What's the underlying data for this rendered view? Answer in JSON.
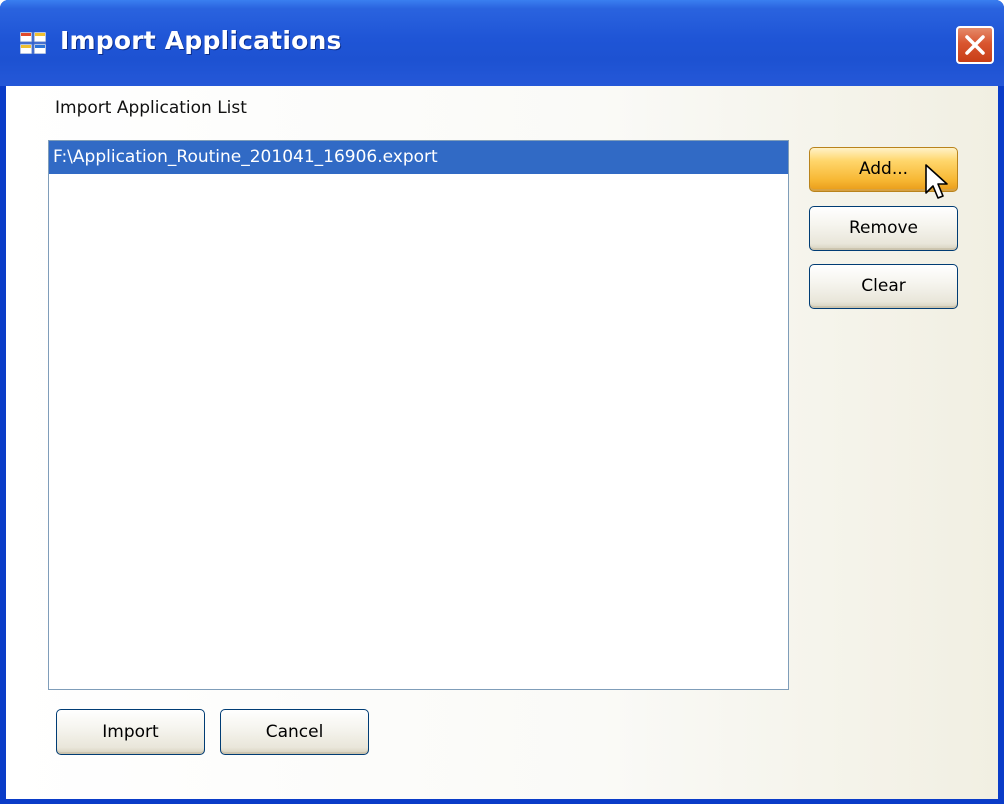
{
  "window": {
    "title": "Import Applications",
    "icon": "app-window-icon",
    "close_icon": "close-icon"
  },
  "form": {
    "list_label": "Import Application List",
    "list_items": [
      {
        "text": "F:\\Application_Routine_201041_16906.export",
        "selected": true
      }
    ]
  },
  "buttons": {
    "add": "Add...",
    "remove": "Remove",
    "clear": "Clear",
    "import": "Import",
    "cancel": "Cancel"
  },
  "colors": {
    "titlebar": "#1f55d6",
    "selection": "#316ac5",
    "hot_button": "#f7b733",
    "close_button": "#d9552f"
  }
}
